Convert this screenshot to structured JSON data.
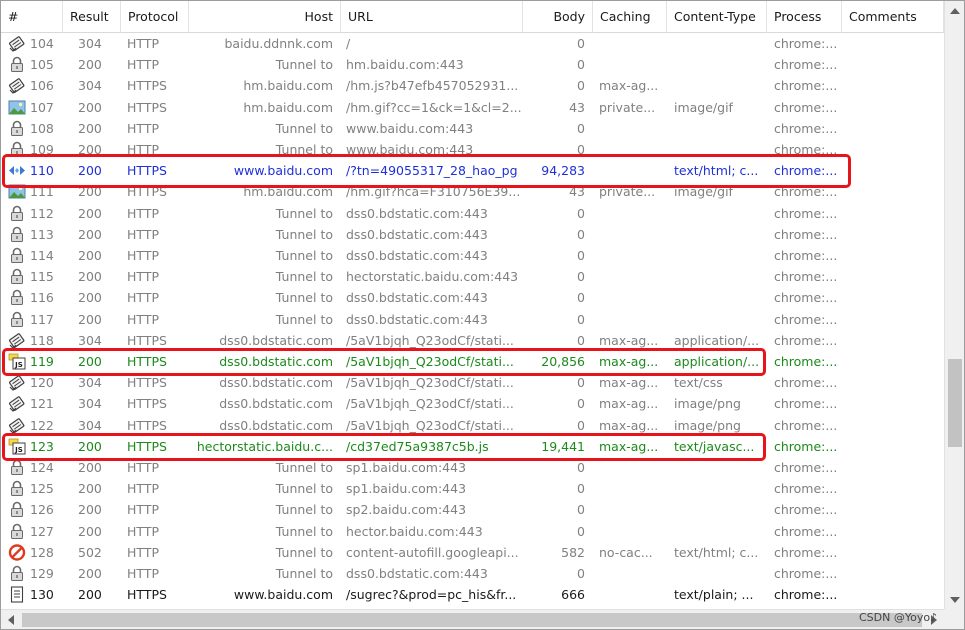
{
  "columns": {
    "num": "#",
    "result": "Result",
    "protocol": "Protocol",
    "host": "Host",
    "url": "URL",
    "body": "Body",
    "caching": "Caching",
    "content_type": "Content-Type",
    "process": "Process",
    "comments": "Comments"
  },
  "sessions": [
    {
      "num": "104",
      "result": "304",
      "protocol": "HTTP",
      "host": "baidu.ddnnk.com",
      "url": "/",
      "body": "0",
      "caching": "",
      "content_type": "",
      "process": "chrome:...",
      "icon": "cached-response-icon",
      "color": "gray"
    },
    {
      "num": "105",
      "result": "200",
      "protocol": "HTTP",
      "host": "Tunnel to",
      "url": "hm.baidu.com:443",
      "body": "0",
      "caching": "",
      "content_type": "",
      "process": "chrome:...",
      "icon": "lock-icon",
      "color": "gray"
    },
    {
      "num": "106",
      "result": "304",
      "protocol": "HTTPS",
      "host": "hm.baidu.com",
      "url": "/hm.js?b47efb457052931...",
      "body": "0",
      "caching": "max-ag...",
      "content_type": "",
      "process": "chrome:...",
      "icon": "cached-response-icon",
      "color": "gray"
    },
    {
      "num": "107",
      "result": "200",
      "protocol": "HTTPS",
      "host": "hm.baidu.com",
      "url": "/hm.gif?cc=1&ck=1&cl=2...",
      "body": "43",
      "caching": "private...",
      "content_type": "image/gif",
      "process": "chrome:...",
      "icon": "image-icon",
      "color": "gray"
    },
    {
      "num": "108",
      "result": "200",
      "protocol": "HTTP",
      "host": "Tunnel to",
      "url": "www.baidu.com:443",
      "body": "0",
      "caching": "",
      "content_type": "",
      "process": "chrome:...",
      "icon": "lock-icon",
      "color": "gray"
    },
    {
      "num": "109",
      "result": "200",
      "protocol": "HTTP",
      "host": "Tunnel to",
      "url": "www.baidu.com:443",
      "body": "0",
      "caching": "",
      "content_type": "",
      "process": "chrome:...",
      "icon": "lock-icon",
      "color": "gray"
    },
    {
      "num": "110",
      "result": "200",
      "protocol": "HTTPS",
      "host": "www.baidu.com",
      "url": "/?tn=49055317_28_hao_pg",
      "body": "94,283",
      "caching": "",
      "content_type": "text/html; c...",
      "process": "chrome:...",
      "icon": "html-icon",
      "color": "blue"
    },
    {
      "num": "111",
      "result": "200",
      "protocol": "HTTPS",
      "host": "hm.baidu.com",
      "url": "/hm.gif?hca=F310756E39...",
      "body": "43",
      "caching": "private...",
      "content_type": "image/gif",
      "process": "chrome:...",
      "icon": "image-icon",
      "color": "gray"
    },
    {
      "num": "112",
      "result": "200",
      "protocol": "HTTP",
      "host": "Tunnel to",
      "url": "dss0.bdstatic.com:443",
      "body": "0",
      "caching": "",
      "content_type": "",
      "process": "chrome:...",
      "icon": "lock-icon",
      "color": "gray"
    },
    {
      "num": "113",
      "result": "200",
      "protocol": "HTTP",
      "host": "Tunnel to",
      "url": "dss0.bdstatic.com:443",
      "body": "0",
      "caching": "",
      "content_type": "",
      "process": "chrome:...",
      "icon": "lock-icon",
      "color": "gray"
    },
    {
      "num": "114",
      "result": "200",
      "protocol": "HTTP",
      "host": "Tunnel to",
      "url": "dss0.bdstatic.com:443",
      "body": "0",
      "caching": "",
      "content_type": "",
      "process": "chrome:...",
      "icon": "lock-icon",
      "color": "gray"
    },
    {
      "num": "115",
      "result": "200",
      "protocol": "HTTP",
      "host": "Tunnel to",
      "url": "hectorstatic.baidu.com:443",
      "body": "0",
      "caching": "",
      "content_type": "",
      "process": "chrome:...",
      "icon": "lock-icon",
      "color": "gray"
    },
    {
      "num": "116",
      "result": "200",
      "protocol": "HTTP",
      "host": "Tunnel to",
      "url": "dss0.bdstatic.com:443",
      "body": "0",
      "caching": "",
      "content_type": "",
      "process": "chrome:...",
      "icon": "lock-icon",
      "color": "gray"
    },
    {
      "num": "117",
      "result": "200",
      "protocol": "HTTP",
      "host": "Tunnel to",
      "url": "dss0.bdstatic.com:443",
      "body": "0",
      "caching": "",
      "content_type": "",
      "process": "chrome:...",
      "icon": "lock-icon",
      "color": "gray"
    },
    {
      "num": "118",
      "result": "304",
      "protocol": "HTTPS",
      "host": "dss0.bdstatic.com",
      "url": "/5aV1bjqh_Q23odCf/stati...",
      "body": "0",
      "caching": "max-ag...",
      "content_type": "application/...",
      "process": "chrome:...",
      "icon": "cached-response-icon",
      "color": "gray"
    },
    {
      "num": "119",
      "result": "200",
      "protocol": "HTTPS",
      "host": "dss0.bdstatic.com",
      "url": "/5aV1bjqh_Q23odCf/stati...",
      "body": "20,856",
      "caching": "max-ag...",
      "content_type": "application/...",
      "process": "chrome:...",
      "icon": "javascript-icon",
      "color": "green"
    },
    {
      "num": "120",
      "result": "304",
      "protocol": "HTTPS",
      "host": "dss0.bdstatic.com",
      "url": "/5aV1bjqh_Q23odCf/stati...",
      "body": "0",
      "caching": "max-ag...",
      "content_type": "text/css",
      "process": "chrome:...",
      "icon": "cached-response-icon",
      "color": "gray"
    },
    {
      "num": "121",
      "result": "304",
      "protocol": "HTTPS",
      "host": "dss0.bdstatic.com",
      "url": "/5aV1bjqh_Q23odCf/stati...",
      "body": "0",
      "caching": "max-ag...",
      "content_type": "image/png",
      "process": "chrome:...",
      "icon": "cached-response-icon",
      "color": "gray"
    },
    {
      "num": "122",
      "result": "304",
      "protocol": "HTTPS",
      "host": "dss0.bdstatic.com",
      "url": "/5aV1bjqh_Q23odCf/stati...",
      "body": "0",
      "caching": "max-ag...",
      "content_type": "image/png",
      "process": "chrome:...",
      "icon": "cached-response-icon",
      "color": "gray"
    },
    {
      "num": "123",
      "result": "200",
      "protocol": "HTTPS",
      "host": "hectorstatic.baidu.c...",
      "url": "/cd37ed75a9387c5b.js",
      "body": "19,441",
      "caching": "max-ag...",
      "content_type": "text/javasc...",
      "process": "chrome:...",
      "icon": "javascript-icon",
      "color": "green"
    },
    {
      "num": "124",
      "result": "200",
      "protocol": "HTTP",
      "host": "Tunnel to",
      "url": "sp1.baidu.com:443",
      "body": "0",
      "caching": "",
      "content_type": "",
      "process": "chrome:...",
      "icon": "lock-icon",
      "color": "gray"
    },
    {
      "num": "125",
      "result": "200",
      "protocol": "HTTP",
      "host": "Tunnel to",
      "url": "sp1.baidu.com:443",
      "body": "0",
      "caching": "",
      "content_type": "",
      "process": "chrome:...",
      "icon": "lock-icon",
      "color": "gray"
    },
    {
      "num": "126",
      "result": "200",
      "protocol": "HTTP",
      "host": "Tunnel to",
      "url": "sp2.baidu.com:443",
      "body": "0",
      "caching": "",
      "content_type": "",
      "process": "chrome:...",
      "icon": "lock-icon",
      "color": "gray"
    },
    {
      "num": "127",
      "result": "200",
      "protocol": "HTTP",
      "host": "Tunnel to",
      "url": "hector.baidu.com:443",
      "body": "0",
      "caching": "",
      "content_type": "",
      "process": "chrome:...",
      "icon": "lock-icon",
      "color": "gray"
    },
    {
      "num": "128",
      "result": "502",
      "protocol": "HTTP",
      "host": "Tunnel to",
      "url": "content-autofill.googleapi...",
      "body": "582",
      "caching": "no-cac...",
      "content_type": "text/html; c...",
      "process": "chrome:...",
      "icon": "error-icon",
      "color": "gray"
    },
    {
      "num": "129",
      "result": "200",
      "protocol": "HTTP",
      "host": "Tunnel to",
      "url": "dss0.bdstatic.com:443",
      "body": "0",
      "caching": "",
      "content_type": "",
      "process": "chrome:...",
      "icon": "lock-icon",
      "color": "gray"
    },
    {
      "num": "130",
      "result": "200",
      "protocol": "HTTPS",
      "host": "www.baidu.com",
      "url": "/sugrec?&prod=pc_his&fr...",
      "body": "666",
      "caching": "",
      "content_type": "text/plain; ...",
      "process": "chrome:...",
      "icon": "document-icon",
      "color": "black"
    }
  ],
  "colors": {
    "highlight": "#e8141b",
    "blue_text": "#1f30d8",
    "green_text": "#1b8a1b"
  },
  "watermark": "CSDN @Yoyo♪"
}
